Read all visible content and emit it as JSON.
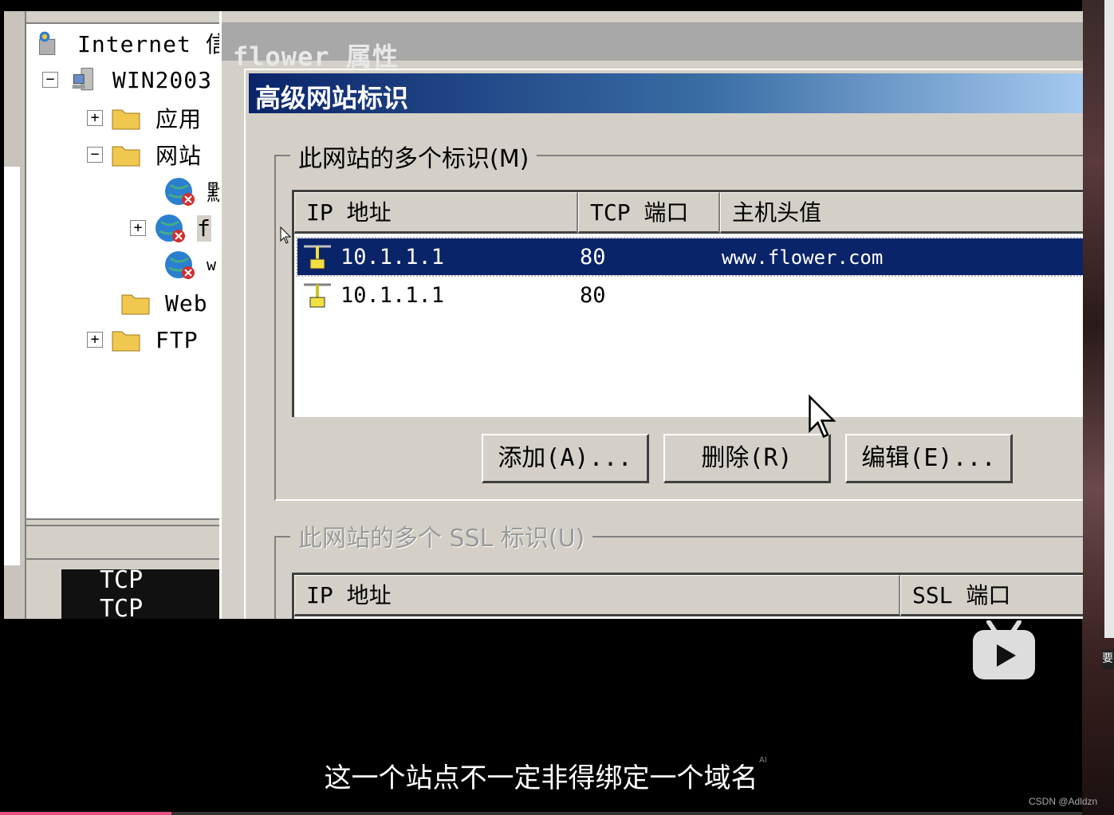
{
  "tree": {
    "root_label": "Internet 信",
    "server_label": "WIN2003",
    "items": [
      {
        "label": "应用",
        "expander": "+"
      },
      {
        "label": "网站",
        "expander": "−"
      },
      {
        "label": "默"
      },
      {
        "label": "f",
        "expander": "+"
      },
      {
        "label": "w"
      },
      {
        "label": "Web"
      },
      {
        "label": "FTP",
        "expander": "+"
      }
    ],
    "behind_text_1": "TCP",
    "behind_text_2": "TCP"
  },
  "properties_window": {
    "title": "flower 属性"
  },
  "advanced_dialog": {
    "title": "高级网站标识",
    "group1": {
      "label": "此网站的多个标识(M)",
      "columns": [
        "IP 地址",
        "TCP 端口",
        "主机头值"
      ],
      "rows": [
        {
          "ip": "10.1.1.1",
          "port": "80",
          "host": "www.flower.com",
          "selected": true
        },
        {
          "ip": "10.1.1.1",
          "port": "80",
          "host": "",
          "selected": false
        }
      ],
      "buttons": {
        "add": "添加(A)...",
        "remove": "删除(R)",
        "edit": "编辑(E)..."
      }
    },
    "group2": {
      "label": "此网站的多个 SSL 标识(U)",
      "columns": [
        "IP 地址",
        "SSL 端口"
      ]
    }
  },
  "video": {
    "subtitle": "这一个站点不一定非得绑定一个域名",
    "ai_mark": "AI",
    "watermark": "CSDN @Adldzn",
    "side_char": "要"
  }
}
